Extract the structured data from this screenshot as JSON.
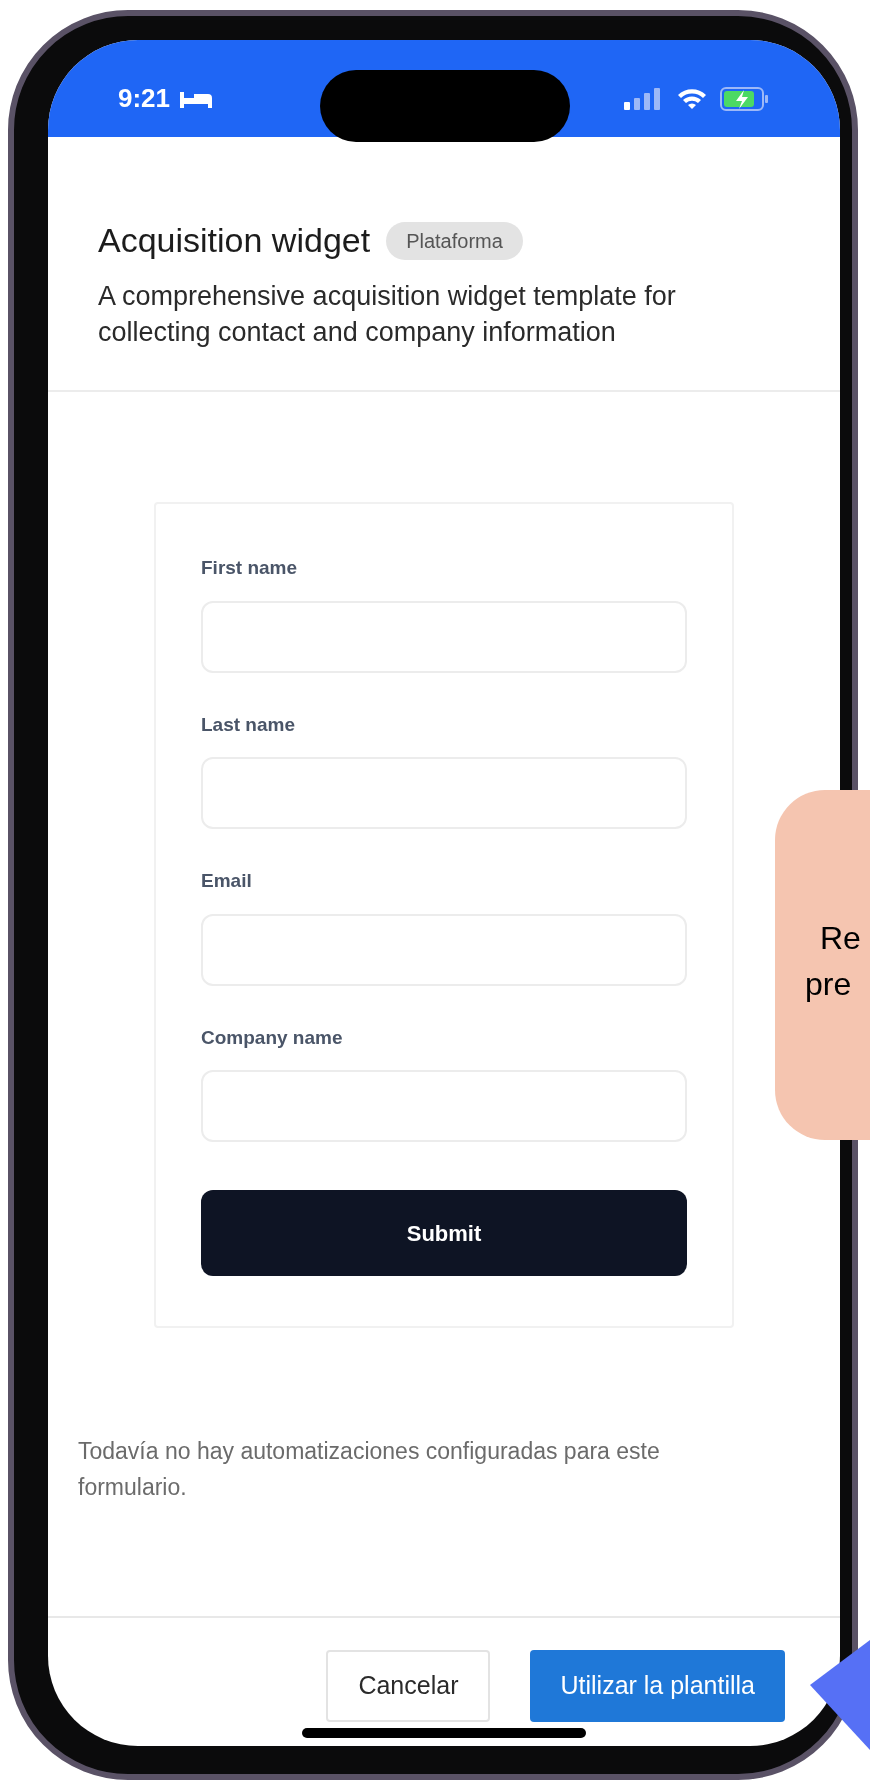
{
  "status_bar": {
    "time": "9:21"
  },
  "header": {
    "title": "Acquisition widget",
    "badge": "Plataforma",
    "description": "A comprehensive acquisition widget template for collecting contact and company information"
  },
  "form": {
    "fields": [
      {
        "label": "First name"
      },
      {
        "label": "Last name"
      },
      {
        "label": "Email"
      },
      {
        "label": "Company name"
      }
    ],
    "submit": "Submit"
  },
  "note": "Todavía no hay automatizaciones configuradas para este formulario.",
  "footer": {
    "buttons": [
      {
        "label": "Cancelar",
        "kind": "secondary"
      },
      {
        "label": "Utilizar la plantilla",
        "kind": "primary"
      }
    ]
  },
  "callout": {
    "lines": [
      "Re",
      "pre"
    ]
  }
}
